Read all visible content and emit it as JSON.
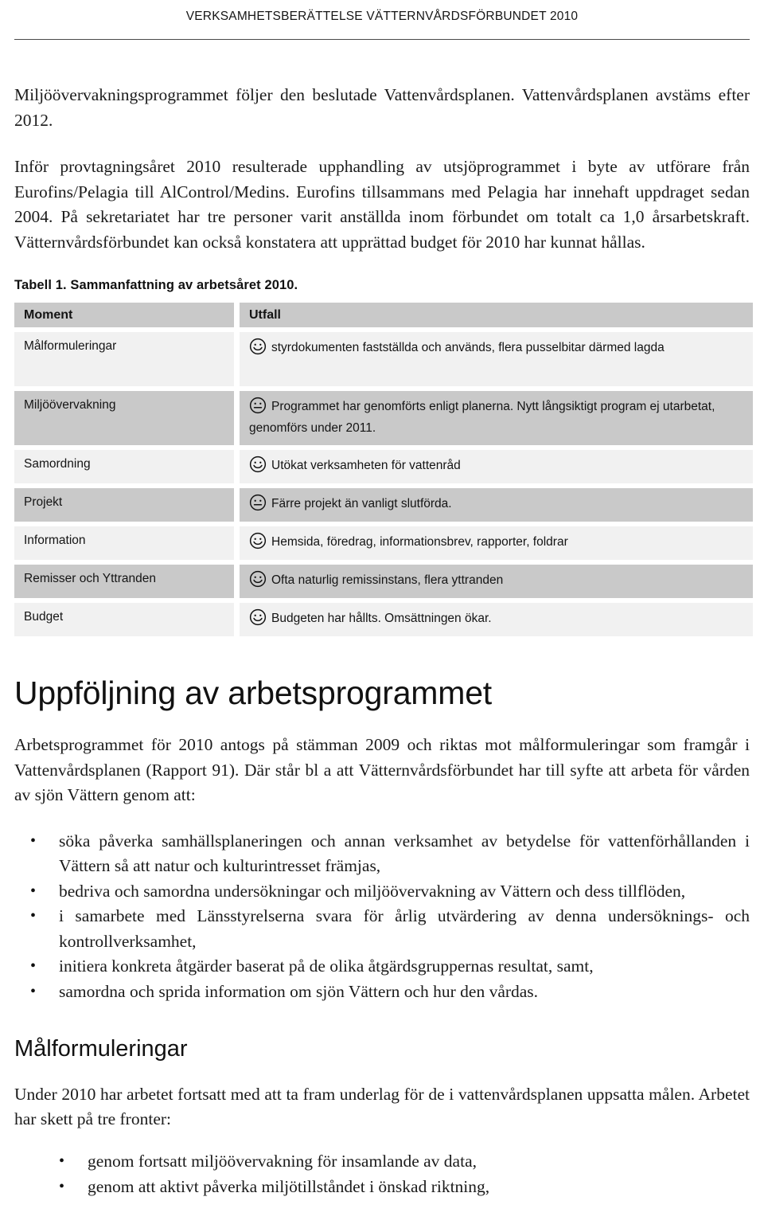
{
  "header": {
    "running_title": "VERKSAMHETSBERÄTTELSE VÄTTERNVÅRDSFÖRBUNDET 2010"
  },
  "intro": {
    "paragraph1": "Miljöövervakningsprogrammet följer den beslutade Vattenvårdsplanen. Vattenvårdsplanen avstäms efter 2012.",
    "paragraph2": "Inför provtagningsåret 2010 resulterade upphandling av utsjöprogrammet i byte av utförare från Eurofins/Pelagia till AlControl/Medins. Eurofins tillsammans med Pelagia har innehaft uppdraget sedan 2004. På sekretariatet har tre personer varit anställda inom förbundet om totalt ca 1,0 årsarbetskraft. Vätternvårdsförbundet kan också konstatera att upprättad budget för 2010 har kunnat hållas."
  },
  "table": {
    "caption": "Tabell 1. Sammanfattning av arbetsåret 2010.",
    "columns": [
      "Moment",
      "Utfall"
    ],
    "rows": [
      {
        "moment": "Målformuleringar",
        "face": "smiley-happy-icon",
        "utfall": "styrdokumenten fastställda och används, flera pusselbitar därmed lagda"
      },
      {
        "moment": "Miljöövervakning",
        "face": "smiley-neutral-icon",
        "utfall": "Programmet har genomförts enligt planerna. Nytt långsiktigt program ej utarbetat, genomförs under 2011."
      },
      {
        "moment": "Samordning",
        "face": "smiley-happy-icon",
        "utfall": "Utökat verksamheten för vattenråd"
      },
      {
        "moment": "Projekt",
        "face": "smiley-neutral-icon",
        "utfall": "Färre projekt än vanligt slutförda."
      },
      {
        "moment": "Information",
        "face": "smiley-happy-icon",
        "utfall": "Hemsida, föredrag, informationsbrev, rapporter, foldrar"
      },
      {
        "moment": "Remisser och Yttranden",
        "face": "smiley-happy-icon",
        "utfall": "Ofta naturlig remissinstans, flera yttranden"
      },
      {
        "moment": "Budget",
        "face": "smiley-happy-icon",
        "utfall": "Budgeten har hållts. Omsättningen ökar."
      }
    ]
  },
  "section_uppfoljning": {
    "heading": "Uppföljning av arbetsprogrammet",
    "paragraph": "Arbetsprogrammet för 2010 antogs på stämman 2009 och riktas mot målformuleringar som framgår i Vattenvårdsplanen (Rapport 91). Där står bl a att Vätternvårdsförbundet har till syfte att arbeta för vården av sjön Vättern genom att:",
    "bullets": [
      "söka påverka samhällsplaneringen och annan verksamhet av betydelse för vattenförhållanden i Vättern så att natur och kulturintresset främjas,",
      "bedriva och samordna undersökningar och miljöövervakning av Vättern och dess tillflöden,",
      "i samarbete med Länsstyrelserna svara för årlig utvärdering av denna undersöknings- och kontrollverksamhet,",
      "initiera konkreta åtgärder baserat på de olika åtgärdsgruppernas resultat, samt,",
      "samordna och sprida information om sjön Vättern och hur den vårdas."
    ]
  },
  "section_malformuleringar": {
    "heading": "Målformuleringar",
    "paragraph": "Under 2010 har arbetet fortsatt med att ta fram underlag för de i vattenvårdsplanen uppsatta målen. Arbetet har skett på tre fronter:",
    "bullets": [
      "genom fortsatt miljöövervakning för insamlande av data,",
      "genom att aktivt påverka miljötillståndet i önskad riktning,"
    ]
  },
  "colors": {
    "header_rule": "#4a4a4a",
    "table_header_bg": "#c9c9c9",
    "table_row_light": "#f1f1f1",
    "table_row_dark": "#c9c9c9",
    "text": "#1b1b1b"
  }
}
